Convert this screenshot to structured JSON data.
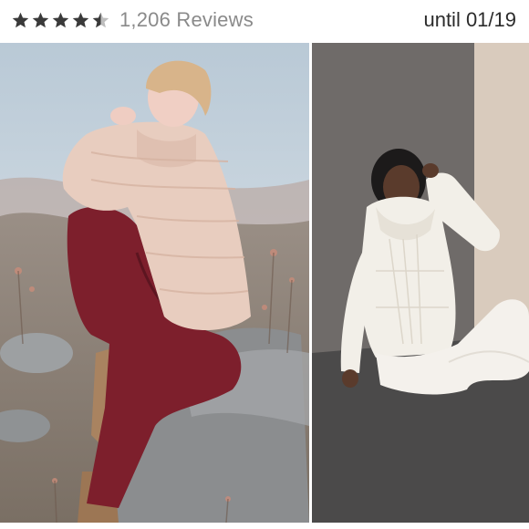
{
  "listing": {
    "rating": {
      "value": 4.5,
      "max": 5,
      "full_star_color": "#3a3a3a",
      "empty_star_color": "#bdbdbd"
    },
    "reviews_text": "1,206 Reviews",
    "until_text": "until 01/19"
  },
  "photos": [
    {
      "name": "outdoor-photo",
      "palette": {
        "sky": "#c9d6df",
        "sweater": "#e8cdbf",
        "pants": "#7d1f2c",
        "boots": "#a98360",
        "rocks": "#8d8f91"
      }
    },
    {
      "name": "studio-photo",
      "palette": {
        "wall": "#6f6b69",
        "floor": "#4b4a4a",
        "panel": "#d9cbbd",
        "sweater": "#f2efe8",
        "pants": "#f4f1ec"
      }
    }
  ]
}
